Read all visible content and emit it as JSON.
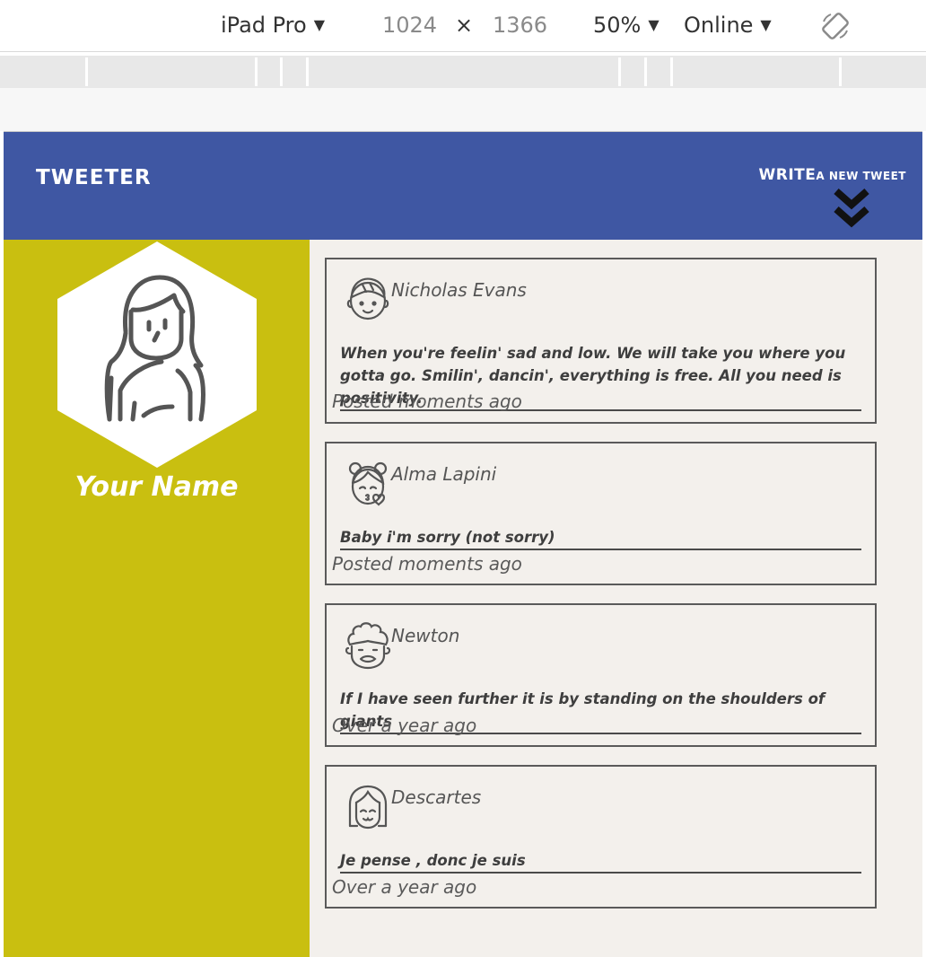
{
  "devtools": {
    "device": "iPad Pro",
    "width": "1024",
    "times": "×",
    "height": "1366",
    "zoom": "50%",
    "network": "Online",
    "caret": "▼"
  },
  "header": {
    "brand": "TWEETER",
    "write_big": "WRITE",
    "write_small": "A NEW TWEET"
  },
  "profile": {
    "name": "Your Name"
  },
  "tweets": [
    {
      "author": "Nicholas Evans",
      "text": "When you're feelin' sad and low. We will take you where you gotta go. Smilin', dancin', everything is free. All you need is positivity.",
      "time": "Posted moments ago",
      "avatar_icon": "boy-face-icon"
    },
    {
      "author": "Alma Lapini",
      "text": "Baby i'm sorry (not sorry)",
      "time": "Posted moments ago",
      "avatar_icon": "girl-kiss-face-icon"
    },
    {
      "author": "Newton",
      "text": "If I have seen further it is by standing on the shoulders of giants",
      "time": "Over a year ago",
      "avatar_icon": "curly-hair-face-icon"
    },
    {
      "author": "Descartes",
      "text": "Je pense , donc je suis",
      "time": "Over a year ago",
      "avatar_icon": "bob-hair-face-icon"
    }
  ],
  "colors": {
    "header": "#3f57a3",
    "sidebar": "#c9bf10",
    "feed_bg": "#f3f0ec"
  }
}
